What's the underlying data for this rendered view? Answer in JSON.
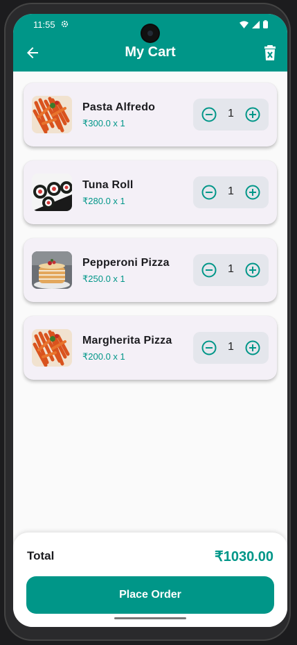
{
  "status_bar": {
    "time": "11:55"
  },
  "header": {
    "title": "My Cart",
    "accent": "#009688"
  },
  "cart": {
    "items": [
      {
        "name": "Pasta Alfredo",
        "price": "₹300.0 x 1",
        "qty": "1",
        "image": "pasta"
      },
      {
        "name": "Tuna Roll",
        "price": "₹280.0 x 1",
        "qty": "1",
        "image": "sushi"
      },
      {
        "name": "Pepperoni Pizza",
        "price": "₹250.0 x 1",
        "qty": "1",
        "image": "pancakes"
      },
      {
        "name": "Margherita Pizza",
        "price": "₹200.0 x 1",
        "qty": "1",
        "image": "pasta"
      }
    ]
  },
  "summary": {
    "total_label": "Total",
    "total_value": "₹1030.00"
  },
  "actions": {
    "place_order": "Place Order"
  },
  "icons": {
    "back": "arrow-back-icon",
    "clear": "trash-icon",
    "decrement": "minus-circle-icon",
    "increment": "plus-circle-icon"
  }
}
